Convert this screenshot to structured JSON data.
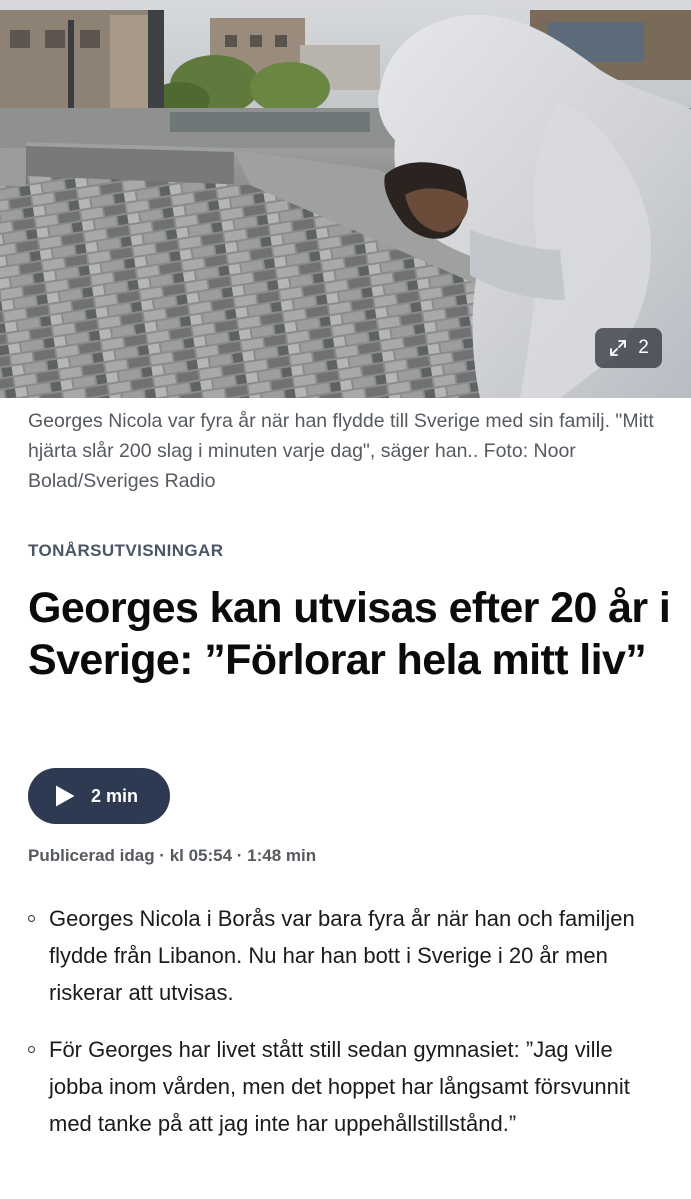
{
  "hero": {
    "gallery_count": "2",
    "icons": [
      "expand-icon"
    ]
  },
  "caption": "Georges Nicola var fyra år när han flydde till Sverige med sin familj. \"Mitt hjärta slår 200 slag i minuten varje dag\", säger han.. Foto: Noor Bolad/Sveriges Radio",
  "article": {
    "category": "TONÅRSUTVISNINGAR",
    "headline": "Georges kan utvisas efter 20 år i Sverige: ”Förlorar hela mitt liv”",
    "audio": {
      "label": "2 min",
      "icon": "play-icon"
    },
    "meta": "Publicerad idag · kl 05:54 · 1:48 min",
    "summary": [
      "Georges Nicola i Borås var bara fyra år när han och familjen flydde från Libanon. Nu har han bott i Sverige i 20 år men riskerar att utvisas.",
      "För Georges har livet stått still sedan gymnasiet: ”Jag ville jobba inom vården, men det hoppet har långsamt försvunnit med tanke på att jag inte har uppehållstillstånd.”"
    ]
  },
  "colors": {
    "accent_button": "#2e3a52",
    "caption_text": "#555a60",
    "category_text": "#4a5566",
    "headline_text": "#0b0b0b"
  }
}
